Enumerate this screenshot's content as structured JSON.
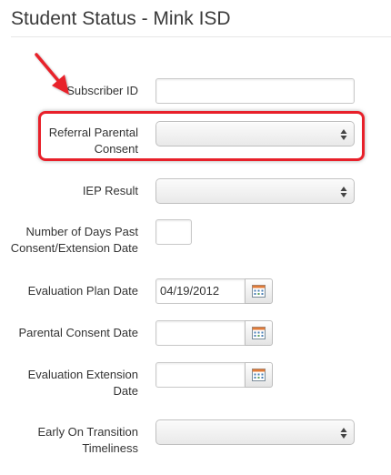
{
  "page": {
    "title": "Student Status - Mink ISD"
  },
  "fields": {
    "subscriber_id": {
      "label": "Subscriber ID",
      "value": ""
    },
    "referral_parental_consent": {
      "label": "Referral Parental Consent",
      "selected": ""
    },
    "iep_result": {
      "label": "IEP Result",
      "selected": ""
    },
    "days_past_consent": {
      "label": "Number of Days Past Consent/Extension Date",
      "value": ""
    },
    "evaluation_plan_date": {
      "label": "Evaluation Plan Date",
      "value": "04/19/2012"
    },
    "parental_consent_date": {
      "label": "Parental Consent Date",
      "value": ""
    },
    "evaluation_extension_date": {
      "label": "Evaluation Extension Date",
      "value": ""
    },
    "early_on_transition_timeliness": {
      "label": "Early On Transition Timeliness",
      "selected": ""
    }
  },
  "annotation": {
    "highlight_color": "#e8202a"
  },
  "icons": {
    "calendar": "calendar-icon",
    "select_arrows": "updown-arrows-icon",
    "pointer": "red-arrow-icon"
  }
}
